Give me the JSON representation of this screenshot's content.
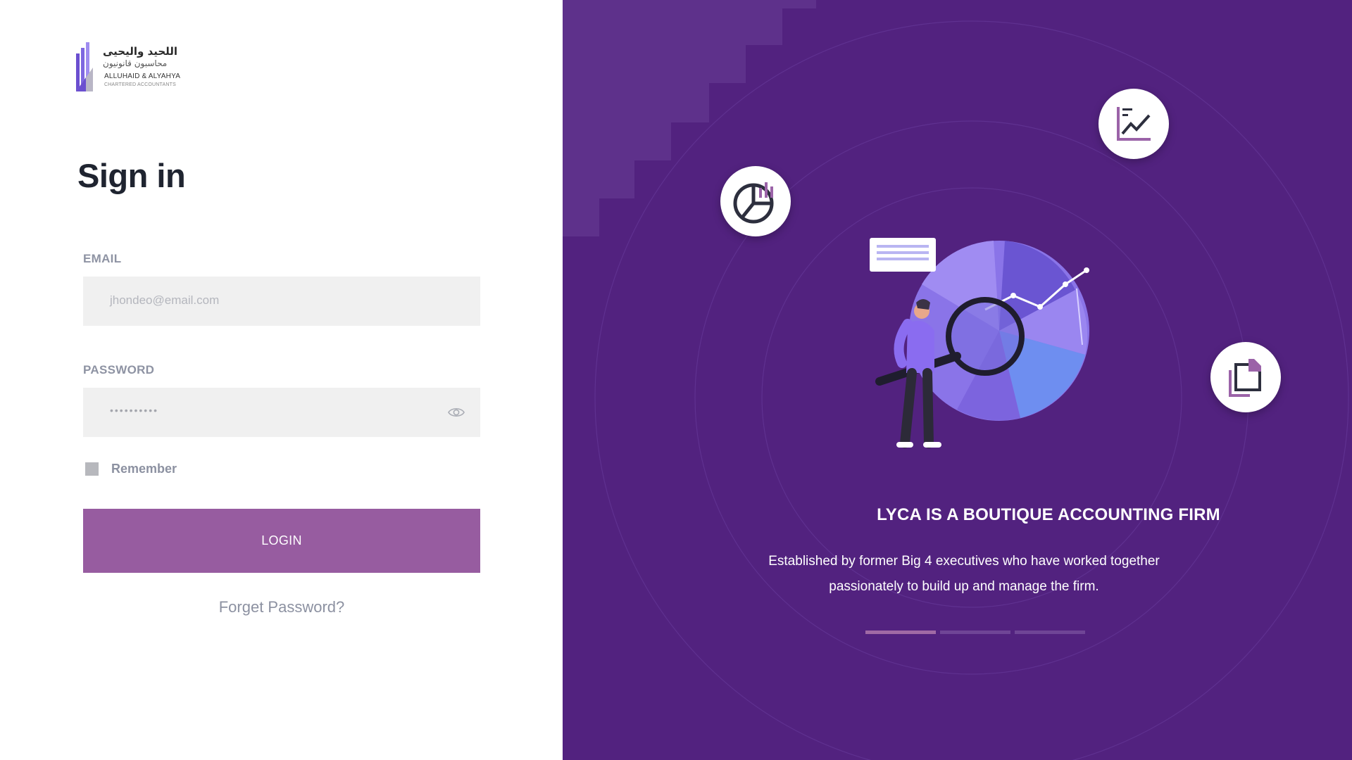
{
  "logo": {
    "arabic_line1": "اللحيد واليحيى",
    "arabic_line2": "محاسبون قانونيون",
    "english_line1": "ALLUHAID & ALYAHYA",
    "english_line2": "CHARTERED ACCOUNTANTS"
  },
  "signin": {
    "title": "Sign in",
    "email_label": "EMAIL",
    "email_placeholder": "jhondeo@email.com",
    "password_label": "PASSWORD",
    "password_masked": "••••••••••",
    "remember_label": "Remember",
    "login_label": "LOGIN",
    "forget_label": "Forget Password?"
  },
  "promo": {
    "headline": "LYCA IS A BOUTIQUE ACCOUNTING FIRM",
    "description": "Established by former Big 4 executives who have worked together passionately to build up and manage the firm.",
    "slides_total": 3,
    "active_slide": 1
  },
  "colors": {
    "panel_bg": "#52227f",
    "accent": "#975ca0",
    "field_bg": "#f0f0f0",
    "label": "#8e93a3"
  },
  "icons": [
    "pie-chart-icon",
    "trend-chart-icon",
    "document-icon",
    "eye-icon"
  ]
}
